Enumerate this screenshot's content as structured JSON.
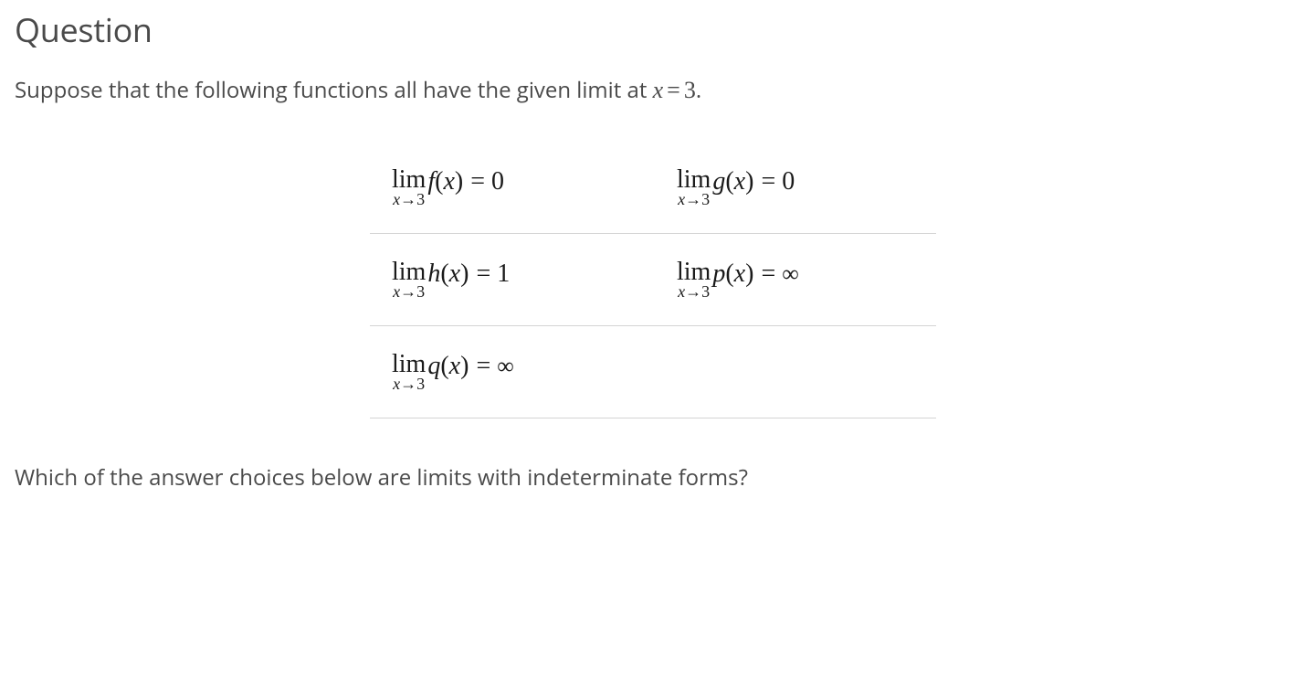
{
  "heading": "Question",
  "intro": {
    "prefix": "Suppose that the following functions all have the given limit at ",
    "var": "x",
    "eq": "=",
    "val": "3",
    "suffix": "."
  },
  "limits": [
    [
      {
        "lim": "lim",
        "sub_x": "x",
        "sub_arrow": "→",
        "sub_val": "3",
        "func_name": "f",
        "func_arg": "x",
        "eq": "=",
        "rhs": "0"
      },
      {
        "lim": "lim",
        "sub_x": "x",
        "sub_arrow": "→",
        "sub_val": "3",
        "func_name": "g",
        "func_arg": "x",
        "eq": "=",
        "rhs": "0"
      }
    ],
    [
      {
        "lim": "lim",
        "sub_x": "x",
        "sub_arrow": "→",
        "sub_val": "3",
        "func_name": "h",
        "func_arg": "x",
        "eq": "=",
        "rhs": "1"
      },
      {
        "lim": "lim",
        "sub_x": "x",
        "sub_arrow": "→",
        "sub_val": "3",
        "func_name": "p",
        "func_arg": "x",
        "eq": "=",
        "rhs": "∞"
      }
    ],
    [
      {
        "lim": "lim",
        "sub_x": "x",
        "sub_arrow": "→",
        "sub_val": "3",
        "func_name": "q",
        "func_arg": "x",
        "eq": "=",
        "rhs": "∞"
      }
    ]
  ],
  "closing": "Which of the answer choices below are limits with indeterminate forms?"
}
